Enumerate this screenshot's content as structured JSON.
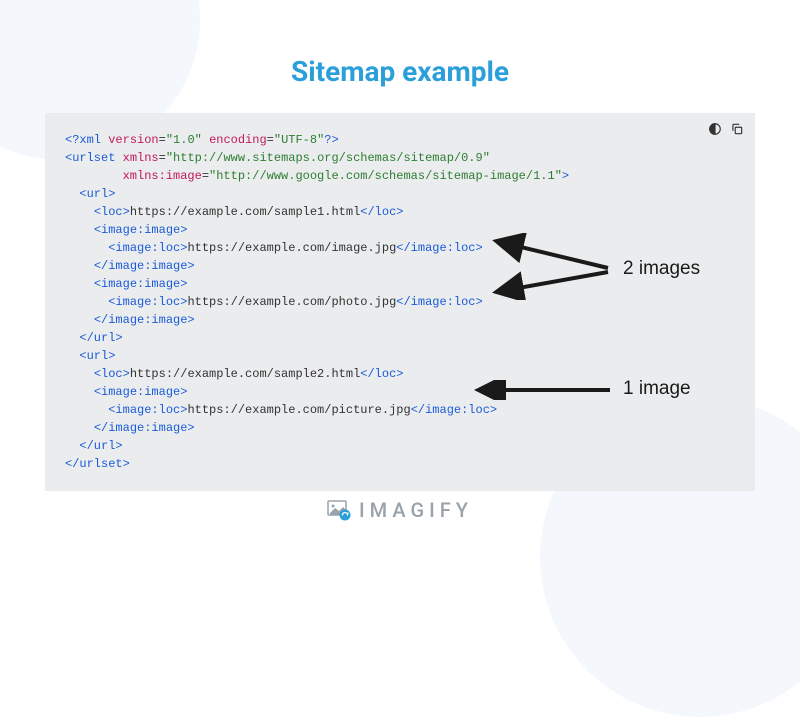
{
  "title": "Sitemap example",
  "annotations": {
    "two_images": "2 images",
    "one_image": "1 image"
  },
  "code": {
    "xml_decl_open": "<?xml",
    "xml_version_attr": "version",
    "xml_version_val": "\"1.0\"",
    "xml_encoding_attr": "encoding",
    "xml_encoding_val": "\"UTF-8\"",
    "xml_decl_close": "?>",
    "urlset_open": "<urlset",
    "xmlns_attr": "xmlns",
    "xmlns_val": "\"http://www.sitemaps.org/schemas/sitemap/0.9\"",
    "xmlns_image_attr": "xmlns:image",
    "xmlns_image_val": "\"http://www.google.com/schemas/sitemap-image/1.1\"",
    "gt": ">",
    "url_open": "<url>",
    "url_close": "</url>",
    "loc_open": "<loc>",
    "loc_close": "</loc>",
    "loc1": "https://example.com/sample1.html",
    "loc2": "https://example.com/sample2.html",
    "image_image_open": "<image:image>",
    "image_image_close": "</image:image>",
    "image_loc_open": "<image:loc>",
    "image_loc_close": "</image:loc>",
    "img1": "https://example.com/image.jpg",
    "img2": "https://example.com/photo.jpg",
    "img3": "https://example.com/picture.jpg",
    "urlset_close": "</urlset>"
  },
  "footer": {
    "brand": "IMAGIFY"
  }
}
